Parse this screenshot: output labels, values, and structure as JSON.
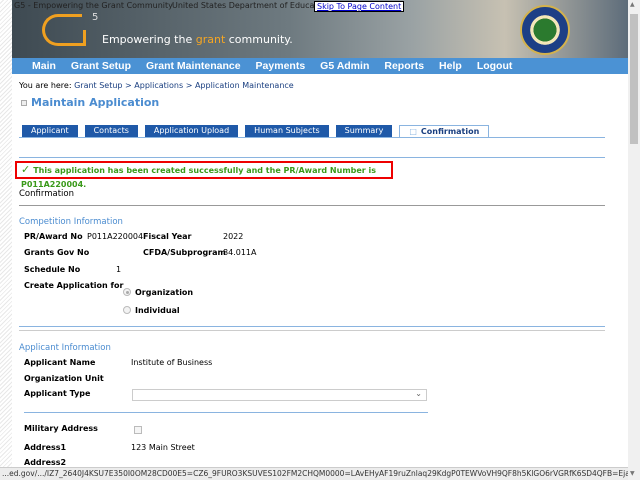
{
  "banner": {
    "alt1": "G5 - Empowering the Grant Community",
    "alt2": "United States Department of Education",
    "skip": "Skip To Page Content",
    "g5_sup": "5",
    "tagline_pre": "Empowering the ",
    "tagline_hl": "grant",
    "tagline_post": " community."
  },
  "nav": [
    "Main",
    "Grant Setup",
    "Grant Maintenance",
    "Payments",
    "G5 Admin",
    "Reports",
    "Help",
    "Logout"
  ],
  "breadcrumb": {
    "prefix": "You are here: ",
    "path": "Grant Setup > Applications > Application Maintenance"
  },
  "page_title": "Maintain Application",
  "tabs": [
    "Applicant",
    "Contacts",
    "Application Upload",
    "Human Subjects",
    "Summary",
    "Confirmation"
  ],
  "active_tab": "Confirmation",
  "message": "This application has been created successfully and the PR/Award Number is P011A220004.",
  "section_heading": "Confirmation",
  "competition": {
    "heading": "Competition Information",
    "pr_award_label": "PR/Award No",
    "pr_award": "P011A220004",
    "fiscal_year_label": "Fiscal Year",
    "fiscal_year": "2022",
    "grants_gov_label": "Grants Gov No",
    "cfda_label": "CFDA/Subprogram",
    "cfda": "84.011A",
    "schedule_label": "Schedule No",
    "schedule": "1",
    "create_for_label": "Create Application for",
    "options": [
      "Organization",
      "Individual"
    ],
    "selected": "Organization"
  },
  "applicant": {
    "heading": "Applicant Information",
    "name_label": "Applicant Name",
    "name": "Institute of Business",
    "org_unit_label": "Organization Unit",
    "type_label": "Applicant Type",
    "type": "",
    "military_label": "Military Address",
    "military": false,
    "address1_label": "Address1",
    "address1": "123 Main Street",
    "address2_label": "Address2"
  },
  "status_url": "...ed.gov/.../IZ7_2640J4KSU7E350I0OM28CD00E5=CZ6_9FURO3KSUVES102FM2CHQM0000=LAvEHyAF19ruZnlaq29KdgP0TEWVoVH9QF8h5KlGO6rVGRfK6SD4QFB=Ejavax.servlet.includ...",
  "colors": {
    "nav": "#4b92d4",
    "tab": "#1f59a8",
    "success": "#3a9a1a",
    "error_border": "#e00000",
    "heading": "#4b8cd0"
  }
}
